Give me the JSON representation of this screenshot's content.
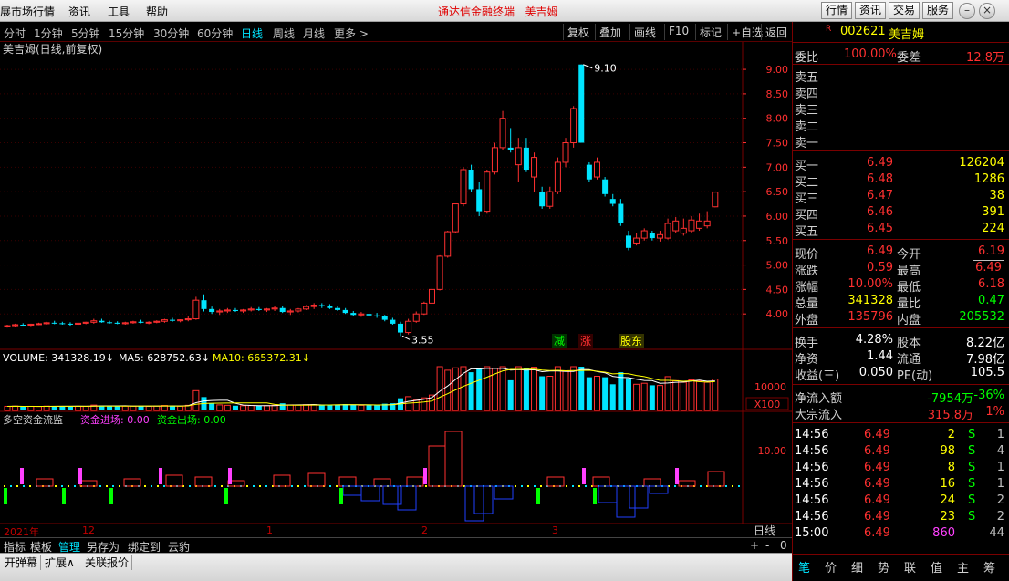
{
  "menu": [
    "展市场行情",
    "资讯",
    "工具",
    "帮助"
  ],
  "app_title": "通达信金融终端",
  "stock_title": "美吉姆",
  "right_buttons": [
    "行情",
    "资讯",
    "交易",
    "服务"
  ],
  "periods": [
    "分时",
    "1分钟",
    "5分钟",
    "15分钟",
    "30分钟",
    "60分钟",
    "日线",
    "周线",
    "月线",
    "更多 >"
  ],
  "active_period": "日线",
  "toolbar": [
    "复权",
    "叠加",
    "画线",
    "F10",
    "标记",
    "+自选",
    "返回"
  ],
  "chart_label": "美吉姆(日线,前复权)",
  "colors": {
    "up": "#ff3030",
    "down": "#00e5ff",
    "ma5": "#ffffff",
    "ma10": "#ffff00",
    "grid": "#7a0000",
    "axis": "#ff3030"
  },
  "chart_data": [
    {
      "type": "candlestick",
      "title": "美吉姆(日线,前复权)",
      "y_ticks": [
        4.0,
        4.5,
        5.0,
        5.5,
        6.0,
        6.5,
        7.0,
        7.5,
        8.0,
        8.5,
        9.0
      ],
      "ylim": [
        3.5,
        9.3
      ],
      "annotations": {
        "high": "9.10",
        "low": "3.55"
      },
      "markers": [
        "减",
        "涨",
        "股东"
      ],
      "candles": [
        [
          3.75,
          3.78,
          3.72,
          3.76
        ],
        [
          3.76,
          3.8,
          3.74,
          3.78
        ],
        [
          3.78,
          3.81,
          3.76,
          3.77
        ],
        [
          3.77,
          3.8,
          3.75,
          3.79
        ],
        [
          3.79,
          3.82,
          3.77,
          3.8
        ],
        [
          3.8,
          3.84,
          3.78,
          3.82
        ],
        [
          3.82,
          3.86,
          3.79,
          3.81
        ],
        [
          3.81,
          3.84,
          3.78,
          3.8
        ],
        [
          3.8,
          3.83,
          3.76,
          3.79
        ],
        [
          3.79,
          3.82,
          3.77,
          3.81
        ],
        [
          3.81,
          3.84,
          3.79,
          3.83
        ],
        [
          3.83,
          3.9,
          3.8,
          3.86
        ],
        [
          3.86,
          3.9,
          3.82,
          3.83
        ],
        [
          3.83,
          3.86,
          3.8,
          3.82
        ],
        [
          3.82,
          3.85,
          3.79,
          3.8
        ],
        [
          3.8,
          3.84,
          3.78,
          3.82
        ],
        [
          3.82,
          3.86,
          3.8,
          3.84
        ],
        [
          3.84,
          3.88,
          3.81,
          3.82
        ],
        [
          3.82,
          3.85,
          3.79,
          3.83
        ],
        [
          3.83,
          3.87,
          3.81,
          3.85
        ],
        [
          3.85,
          3.9,
          3.82,
          3.88
        ],
        [
          3.88,
          3.92,
          3.84,
          3.86
        ],
        [
          3.86,
          3.89,
          3.83,
          3.88
        ],
        [
          3.88,
          3.95,
          3.85,
          3.9
        ],
        [
          3.9,
          4.35,
          3.88,
          4.28
        ],
        [
          4.28,
          4.4,
          4.05,
          4.1
        ],
        [
          4.1,
          4.15,
          4.0,
          4.04
        ],
        [
          4.04,
          4.1,
          3.98,
          4.06
        ],
        [
          4.06,
          4.12,
          4.02,
          4.08
        ],
        [
          4.08,
          4.12,
          4.04,
          4.06
        ],
        [
          4.06,
          4.1,
          4.02,
          4.08
        ],
        [
          4.08,
          4.14,
          4.05,
          4.1
        ],
        [
          4.1,
          4.14,
          4.06,
          4.08
        ],
        [
          4.08,
          4.12,
          4.04,
          4.1
        ],
        [
          4.1,
          4.16,
          4.06,
          4.12
        ],
        [
          4.12,
          4.16,
          4.02,
          4.04
        ],
        [
          4.04,
          4.1,
          3.98,
          4.06
        ],
        [
          4.06,
          4.12,
          4.03,
          4.1
        ],
        [
          4.1,
          4.18,
          4.08,
          4.15
        ],
        [
          4.15,
          4.22,
          4.1,
          4.18
        ],
        [
          4.18,
          4.22,
          4.12,
          4.16
        ],
        [
          4.16,
          4.2,
          4.1,
          4.12
        ],
        [
          4.12,
          4.16,
          4.06,
          4.08
        ],
        [
          4.08,
          4.12,
          4.0,
          4.02
        ],
        [
          4.02,
          4.06,
          3.96,
          3.98
        ],
        [
          3.98,
          4.04,
          3.94,
          4.0
        ],
        [
          4.0,
          4.04,
          3.95,
          3.97
        ],
        [
          3.97,
          4.02,
          3.92,
          3.95
        ],
        [
          3.95,
          3.98,
          3.85,
          3.88
        ],
        [
          3.88,
          3.92,
          3.78,
          3.8
        ],
        [
          3.8,
          3.84,
          3.55,
          3.62
        ],
        [
          3.62,
          3.9,
          3.58,
          3.85
        ],
        [
          3.85,
          4.05,
          3.82,
          4.0
        ],
        [
          4.0,
          4.25,
          3.98,
          4.22
        ],
        [
          4.22,
          4.55,
          4.2,
          4.5
        ],
        [
          4.5,
          5.2,
          4.48,
          5.18
        ],
        [
          5.18,
          5.7,
          5.15,
          5.68
        ],
        [
          5.68,
          6.25,
          5.65,
          6.25
        ],
        [
          6.25,
          7.0,
          6.2,
          6.95
        ],
        [
          6.95,
          7.05,
          6.5,
          6.55
        ],
        [
          6.55,
          6.7,
          6.0,
          6.1
        ],
        [
          6.1,
          6.95,
          6.05,
          6.9
        ],
        [
          6.9,
          7.5,
          6.85,
          7.4
        ],
        [
          7.4,
          8.15,
          7.35,
          8.0
        ],
        [
          7.4,
          7.8,
          7.3,
          7.35
        ],
        [
          7.05,
          7.6,
          6.7,
          7.4
        ],
        [
          7.4,
          7.6,
          6.9,
          6.95
        ],
        [
          6.8,
          7.3,
          6.5,
          7.2
        ],
        [
          6.5,
          6.6,
          6.15,
          6.2
        ],
        [
          6.2,
          6.6,
          6.15,
          6.5
        ],
        [
          6.5,
          7.2,
          6.45,
          7.1
        ],
        [
          7.1,
          7.6,
          7.0,
          7.5
        ],
        [
          7.5,
          8.25,
          7.4,
          8.2
        ],
        [
          9.1,
          9.1,
          7.5,
          7.5
        ],
        [
          7.05,
          7.1,
          6.7,
          6.75
        ],
        [
          6.8,
          7.2,
          6.75,
          7.1
        ],
        [
          6.75,
          6.8,
          6.4,
          6.45
        ],
        [
          6.35,
          6.45,
          6.2,
          6.25
        ],
        [
          6.25,
          6.35,
          5.8,
          5.85
        ],
        [
          5.6,
          5.7,
          5.3,
          5.35
        ],
        [
          5.45,
          5.65,
          5.4,
          5.55
        ],
        [
          5.55,
          5.75,
          5.5,
          5.7
        ],
        [
          5.65,
          5.7,
          5.5,
          5.55
        ],
        [
          5.55,
          5.7,
          5.48,
          5.62
        ],
        [
          5.55,
          5.95,
          5.52,
          5.85
        ],
        [
          5.7,
          5.98,
          5.65,
          5.9
        ],
        [
          5.65,
          5.95,
          5.6,
          5.75
        ],
        [
          5.7,
          6.0,
          5.65,
          5.92
        ],
        [
          5.75,
          6.05,
          5.7,
          5.9
        ],
        [
          5.8,
          6.1,
          5.75,
          5.9
        ],
        [
          6.19,
          6.49,
          6.18,
          6.49
        ]
      ]
    },
    {
      "type": "bar",
      "title": "VOLUME",
      "series": [
        {
          "name": "VOLUME",
          "value": "341328.19"
        },
        {
          "name": "MA5",
          "value": "628752.63"
        },
        {
          "name": "MA10",
          "value": "665372.31"
        }
      ],
      "y_ticks": [
        "10000"
      ],
      "unit": "X100"
    },
    {
      "type": "bar",
      "title": "多空资金流监",
      "series": [
        {
          "name": "资金进场",
          "value": "0.00"
        },
        {
          "name": "资金出场",
          "value": "0.00"
        }
      ],
      "y_ticks": [
        "10.00"
      ]
    }
  ],
  "time_axis": [
    "2021年",
    "12",
    "1",
    "2",
    "3"
  ],
  "quote": {
    "code": "002621",
    "name": "美吉姆",
    "wei_bi_label": "委比",
    "wei_bi": "100.00%",
    "wei_cha_label": "委差",
    "wei_cha": "12.8万",
    "sell": [
      {
        "label": "卖五"
      },
      {
        "label": "卖四"
      },
      {
        "label": "卖三"
      },
      {
        "label": "卖二"
      },
      {
        "label": "卖一"
      }
    ],
    "buy": [
      {
        "label": "买一",
        "price": "6.49",
        "vol": "126204"
      },
      {
        "label": "买二",
        "price": "6.48",
        "vol": "1286"
      },
      {
        "label": "买三",
        "price": "6.47",
        "vol": "38"
      },
      {
        "label": "买四",
        "price": "6.46",
        "vol": "391"
      },
      {
        "label": "买五",
        "price": "6.45",
        "vol": "224"
      }
    ],
    "stats": [
      [
        {
          "l": "现价",
          "v": "6.49",
          "c": "#ff3030"
        },
        {
          "l": "今开",
          "v": "6.19",
          "c": "#ff3030"
        }
      ],
      [
        {
          "l": "涨跌",
          "v": "0.59",
          "c": "#ff3030"
        },
        {
          "l": "最高",
          "v": "6.49",
          "c": "#ff3030"
        }
      ],
      [
        {
          "l": "涨幅",
          "v": "10.00%",
          "c": "#ff3030"
        },
        {
          "l": "最低",
          "v": "6.18",
          "c": "#ff3030"
        }
      ],
      [
        {
          "l": "总量",
          "v": "341328",
          "c": "#ffff00"
        },
        {
          "l": "量比",
          "v": "0.47",
          "c": "#00ff00"
        }
      ],
      [
        {
          "l": "外盘",
          "v": "135796",
          "c": "#ff3030"
        },
        {
          "l": "内盘",
          "v": "205532",
          "c": "#00ff00"
        }
      ]
    ],
    "stats2": [
      [
        {
          "l": "换手",
          "v": "4.28%",
          "c": "#ffffff"
        },
        {
          "l": "股本",
          "v": "8.22亿",
          "c": "#ffffff"
        }
      ],
      [
        {
          "l": "净资",
          "v": "1.44",
          "c": "#ffffff"
        },
        {
          "l": "流通",
          "v": "7.98亿",
          "c": "#ffffff"
        }
      ],
      [
        {
          "l": "收益(三)",
          "v": "0.050",
          "c": "#ffffff"
        },
        {
          "l": "PE(动)",
          "v": "105.5",
          "c": "#ffffff"
        }
      ]
    ],
    "net_inflow_label": "净流入额",
    "net_inflow": "-7954万",
    "net_inflow_pct": "-36%",
    "block_label": "大宗流入",
    "block": "315.8万",
    "block_pct": "1%",
    "ticks": [
      {
        "t": "14:56",
        "p": "6.49",
        "v": "2",
        "d": "S",
        "n": "1"
      },
      {
        "t": "14:56",
        "p": "6.49",
        "v": "98",
        "d": "S",
        "n": "4"
      },
      {
        "t": "14:56",
        "p": "6.49",
        "v": "8",
        "d": "S",
        "n": "1"
      },
      {
        "t": "14:56",
        "p": "6.49",
        "v": "16",
        "d": "S",
        "n": "1"
      },
      {
        "t": "14:56",
        "p": "6.49",
        "v": "24",
        "d": "S",
        "n": "2"
      },
      {
        "t": "14:56",
        "p": "6.49",
        "v": "23",
        "d": "S",
        "n": "2"
      },
      {
        "t": "15:00",
        "p": "6.49",
        "v": "860",
        "d": "",
        "n": "44"
      }
    ],
    "tabs": [
      "笔",
      "价",
      "细",
      "势",
      "联",
      "值",
      "主",
      "筹"
    ]
  },
  "bottom_tabs": [
    "指标",
    "模板",
    "管理",
    "另存为",
    "绑定到",
    "云豹"
  ],
  "active_bottom_tab": "管理",
  "period_label_right": "日线",
  "zoom_controls": [
    "+",
    "-",
    "0"
  ],
  "status": [
    "开弹幕",
    "扩展∧",
    "关联报价"
  ]
}
